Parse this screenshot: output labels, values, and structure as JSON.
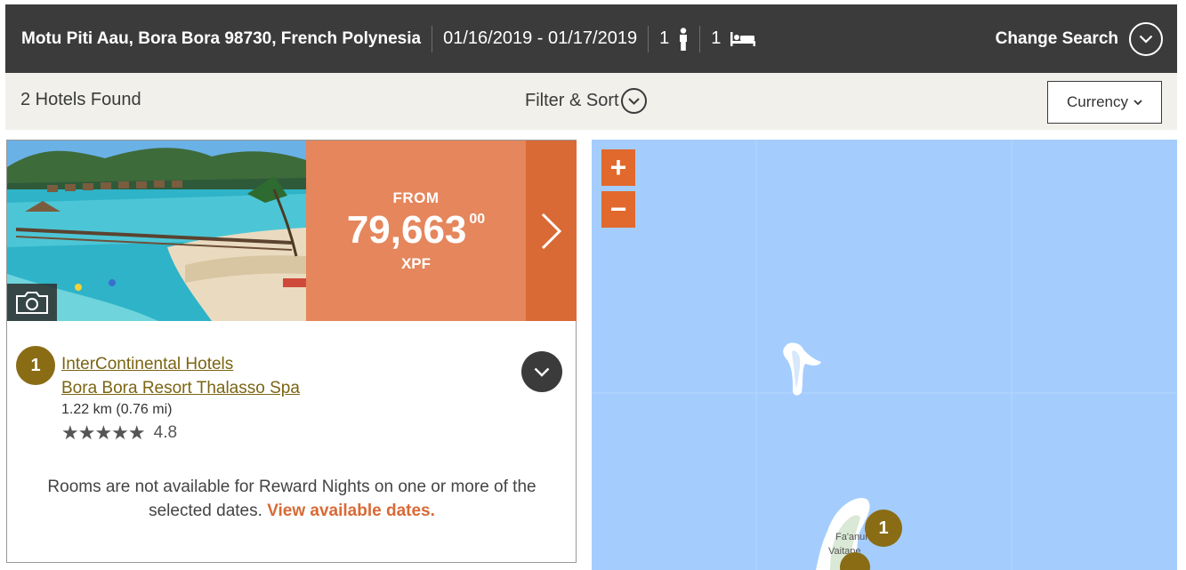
{
  "search": {
    "location": "Motu Piti Aau, Bora Bora 98730, French Polynesia",
    "dates": "01/16/2019 - 01/17/2019",
    "guests": "1",
    "guest_icon": "person-icon",
    "rooms": "1",
    "room_icon": "bed-icon",
    "change_label": "Change Search"
  },
  "results": {
    "found_label": "2 Hotels Found",
    "filter_label": "Filter & Sort",
    "currency_label": "Currency"
  },
  "hotel": {
    "number": "1",
    "name_line1": "InterContinental Hotels",
    "name_line2": "Bora Bora Resort Thalasso Spa",
    "distance": "1.22 km (0.76 mi)",
    "stars_glyph": "★★★★★",
    "rating": "4.8",
    "price": {
      "from_label": "FROM",
      "amount": "79,663",
      "cents": "00",
      "currency": "XPF"
    },
    "notice_text": "Rooms are not available for Reward Nights on one or more of the selected dates.",
    "notice_link": "View available dates."
  },
  "map": {
    "zoom_in": "+",
    "zoom_out": "−",
    "place_label_1": "Fa'anui",
    "place_label_2": "Vaitape",
    "marker_number": "1"
  },
  "colors": {
    "header_bg": "#3c3b3b",
    "price_bg": "#e5865c",
    "arrow_bg": "#d96a36",
    "badge": "#8a6c15",
    "map_water": "#a4cdfd"
  }
}
